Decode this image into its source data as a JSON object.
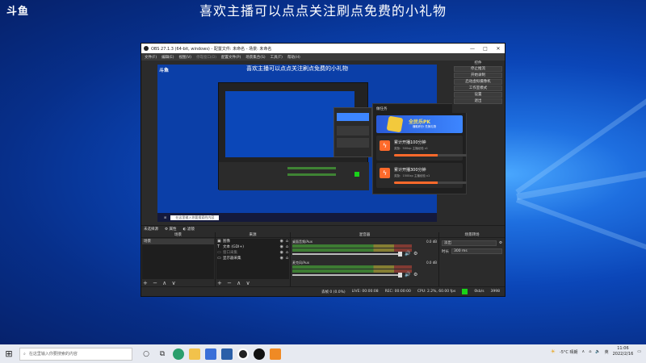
{
  "desktop": {
    "logo": "斗鱼",
    "banner": "喜欢主播可以点点关注刷点免费的小礼物"
  },
  "obs": {
    "title": "OBS 27.1.3 (64-bit, windows) - 配置文件: 未命名 - 场景: 未命名",
    "window_buttons": [
      "—",
      "□",
      "✕"
    ],
    "menu": [
      "文件(F)",
      "编辑(E)",
      "视图(V)",
      "停靠窗口(D)",
      "配置文件(P)",
      "场景集合(S)",
      "工具(T)",
      "帮助(H)"
    ],
    "preview": {
      "logo": "斗鱼",
      "banner": "喜欢主播可以点点关注刷点免费的小礼物"
    },
    "task_panel": {
      "title": "做任务",
      "close": "✕",
      "banner_title": "全民乐PK",
      "banner_sub": "赚取积分 兑换礼物",
      "cards": [
        {
          "title": "累计开播100分钟",
          "desc": "奖励：500xp 主播经验 x1",
          "progress": 0.6
        },
        {
          "title": "累计开播300分钟",
          "desc": "奖励：1500xp 主播经验 x1",
          "progress": 0.6
        }
      ]
    },
    "controls": {
      "header": "控件",
      "buttons": [
        "停止推流",
        "开始录制",
        "启动虚拟摄像机",
        "工作室模式",
        "设置",
        "退出"
      ]
    },
    "dockbar": {
      "scene_label": "未选择源",
      "properties": "属性",
      "filters": "滤镜"
    },
    "docks": {
      "scenes": {
        "header": "场景",
        "items": [
          "场景"
        ]
      },
      "sources": {
        "header": "来源",
        "items": [
          {
            "icon": "▣",
            "label": "图像"
          },
          {
            "icon": "T",
            "label": "文本 (GDI+)"
          },
          {
            "icon": "▭",
            "label": "窗口采集"
          },
          {
            "icon": "▭",
            "label": "显示器采集"
          }
        ]
      },
      "mixer": {
        "header": "混音器",
        "channels": [
          {
            "name": "桌面音频/Aux",
            "db": "0.0 dB"
          },
          {
            "name": "麦克风/Aux",
            "db": "0.0 dB"
          }
        ]
      },
      "transitions": {
        "header": "场景转场",
        "type": "淡出",
        "duration_label": "时长",
        "duration": "300 ms"
      }
    },
    "toolbar_glyphs": "+ − ∧ ∨",
    "status": {
      "dropped": "丢帧 0 (0.0%)",
      "live": "LIVE: 00:00:08",
      "rec": "REC: 00:00:00",
      "cpu": "CPU: 2.2%, 60.00 fps",
      "bitrate": "0kb/s",
      "bitrate2": "3998"
    }
  },
  "taskbar": {
    "search_placeholder": "在这里输入你要搜索的内容",
    "weather": "-5°C 晴朗",
    "time": "11:06",
    "date": "2022/2/16"
  }
}
